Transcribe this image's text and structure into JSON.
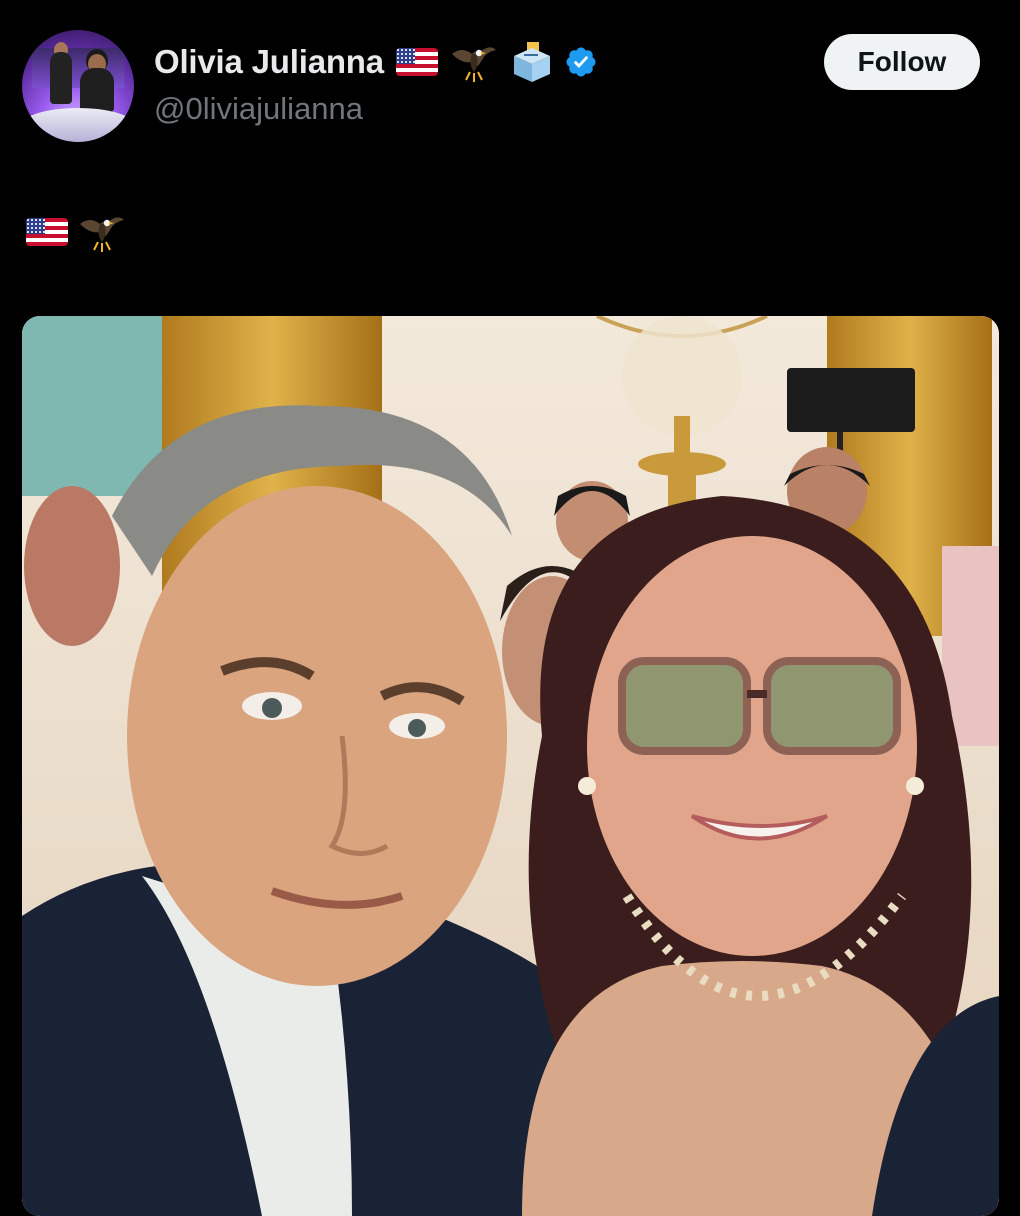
{
  "author": {
    "display_name": "Olivia Julianna",
    "handle": "@0liviajulianna",
    "name_emojis": [
      "us-flag-icon",
      "eagle-icon",
      "ballot-box-icon"
    ],
    "verified": true
  },
  "follow_button": {
    "label": "Follow"
  },
  "tweet": {
    "text_emojis": [
      "us-flag-icon",
      "eagle-icon"
    ]
  },
  "colors": {
    "background": "#000000",
    "text_primary": "#e7e9ea",
    "text_secondary": "#71767b",
    "verified_blue": "#1d9bf0",
    "button_bg": "#eff3f4"
  }
}
